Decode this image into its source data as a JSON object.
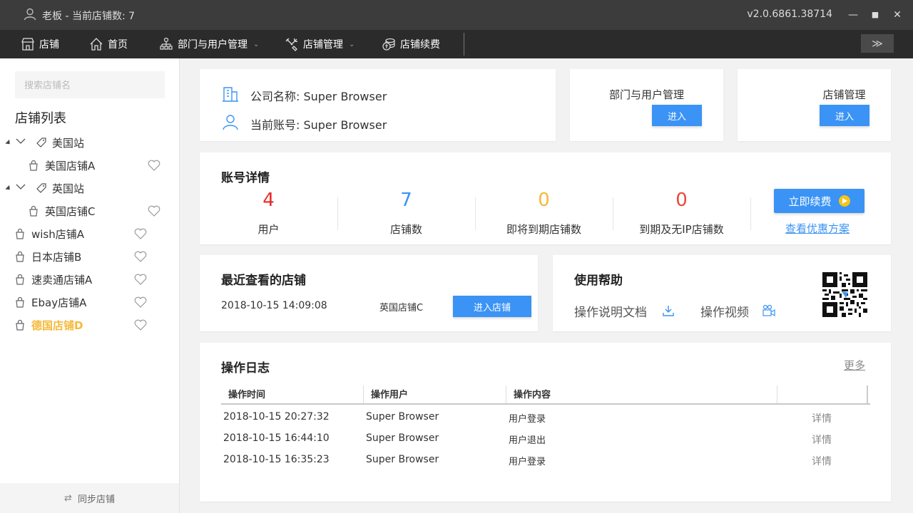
{
  "titlebar": {
    "title": "老板 - 当前店铺数: 7",
    "version": "v2.0.6861.38714",
    "min": "—",
    "max": "■",
    "close": "✕"
  },
  "nav": {
    "items": [
      {
        "label": "店铺",
        "icon": "shop-icon"
      },
      {
        "label": "首页",
        "icon": "home-icon"
      },
      {
        "label": "部门与用户管理",
        "icon": "org-icon"
      },
      {
        "label": "店铺管理",
        "icon": "tools-icon"
      },
      {
        "label": "店铺续费",
        "icon": "coins-icon"
      }
    ],
    "expand": "≫"
  },
  "sidebar": {
    "search_placeholder": "搜索店铺名",
    "title": "店铺列表",
    "tree": [
      {
        "label": "美国站",
        "type": "group"
      },
      {
        "label": "美国店铺A",
        "type": "child"
      },
      {
        "label": "英国站",
        "type": "group"
      },
      {
        "label": "英国店铺C",
        "type": "child"
      },
      {
        "label": "wish店铺A",
        "type": "item"
      },
      {
        "label": "日本店铺B",
        "type": "item"
      },
      {
        "label": "速卖通店铺A",
        "type": "item"
      },
      {
        "label": "Ebay店铺A",
        "type": "item"
      },
      {
        "label": "德国店铺D",
        "type": "item",
        "active": true
      }
    ],
    "sync_label": "同步店铺",
    "active_color": "#f5b93b"
  },
  "company": {
    "name_label": "公司名称: Super Browser",
    "account_label": "当前账号: Super Browser"
  },
  "shortcuts": [
    {
      "title": "部门与用户管理",
      "button": "进入"
    },
    {
      "title": "店铺管理",
      "button": "进入"
    }
  ],
  "account": {
    "title": "账号详情",
    "stats": [
      {
        "value": "4",
        "label": "用户",
        "color": "#e82a2a"
      },
      {
        "value": "7",
        "label": "店铺数",
        "color": "#3a93f5"
      },
      {
        "value": "0",
        "label": "即将到期店铺数",
        "color": "#f5b93b"
      },
      {
        "value": "0",
        "label": "到期及无IP店铺数",
        "color": "#e84a3a"
      }
    ],
    "renew_button": "立即续费",
    "offer_link": "查看优惠方案"
  },
  "recent": {
    "title": "最近查看的店铺",
    "time": "2018-10-15 14:09:08",
    "shop": "英国店铺C",
    "button": "进入店铺"
  },
  "help": {
    "title": "使用帮助",
    "doc": "操作说明文档",
    "video": "操作视频"
  },
  "log": {
    "title": "操作日志",
    "more": "更多",
    "headers": [
      "操作时间",
      "操作用户",
      "操作内容"
    ],
    "rows": [
      {
        "time": "2018-10-15 20:27:32",
        "user": "Super Browser",
        "content": "用户登录",
        "action": "详情"
      },
      {
        "time": "2018-10-15 16:44:10",
        "user": "Super Browser",
        "content": "用户退出",
        "action": "详情"
      },
      {
        "time": "2018-10-15 16:35:23",
        "user": "Super Browser",
        "content": "用户登录",
        "action": "详情"
      }
    ]
  },
  "colors": {
    "accent": "#3a93f5",
    "titlebar": "#3c3c3c",
    "navbar": "#2b2b2b"
  }
}
